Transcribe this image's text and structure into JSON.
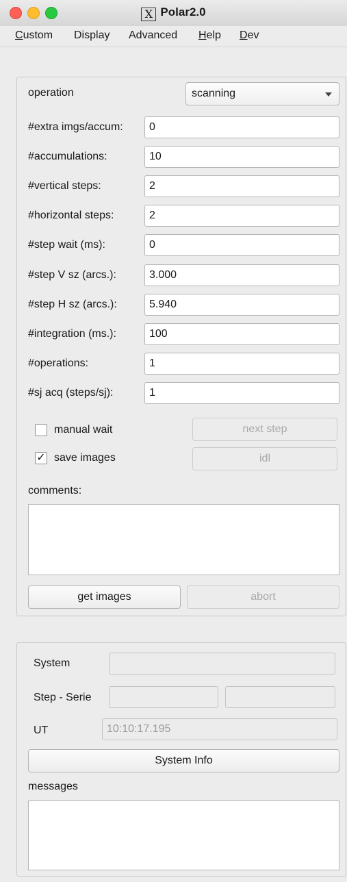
{
  "window": {
    "title": "Polar2.0"
  },
  "menu": [
    {
      "label": "Custom"
    },
    {
      "label": "Display"
    },
    {
      "label": "Advanced"
    },
    {
      "label": "Help"
    },
    {
      "label": "Dev"
    }
  ],
  "acquisition": {
    "operation_label": "operation",
    "operation_value": "scanning",
    "fields": [
      {
        "label": "#extra imgs/accum:",
        "value": "0"
      },
      {
        "label": "#accumulations:",
        "value": "10"
      },
      {
        "label": "#vertical steps:",
        "value": "2"
      },
      {
        "label": "#horizontal steps:",
        "value": "2"
      },
      {
        "label": "#step wait (ms):",
        "value": "0"
      },
      {
        "label": "#step V sz (arcs.):",
        "value": "3.000"
      },
      {
        "label": "#step H sz (arcs.):",
        "value": "5.940"
      },
      {
        "label": "#integration (ms.):",
        "value": "100"
      },
      {
        "label": "#operations:",
        "value": "1"
      },
      {
        "label": "#sj acq (steps/sj):",
        "value": "1"
      }
    ],
    "manual_wait_label": "manual wait",
    "manual_wait_checked": false,
    "save_images_label": "save images",
    "save_images_checked": true,
    "check_mark": "✓",
    "next_step_label": "next step",
    "idl_label": "idl",
    "comments_label": "comments:",
    "comments_value": "",
    "get_images_label": "get images",
    "abort_label": "abort"
  },
  "status": {
    "system_label": "System",
    "system_value": "",
    "step_serie_label": "Step - Serie",
    "step_value": "",
    "serie_value": "",
    "ut_label": "UT",
    "ut_value": "10:10:17.195",
    "system_info_label": "System Info",
    "messages_label": "messages",
    "messages_value": ""
  }
}
